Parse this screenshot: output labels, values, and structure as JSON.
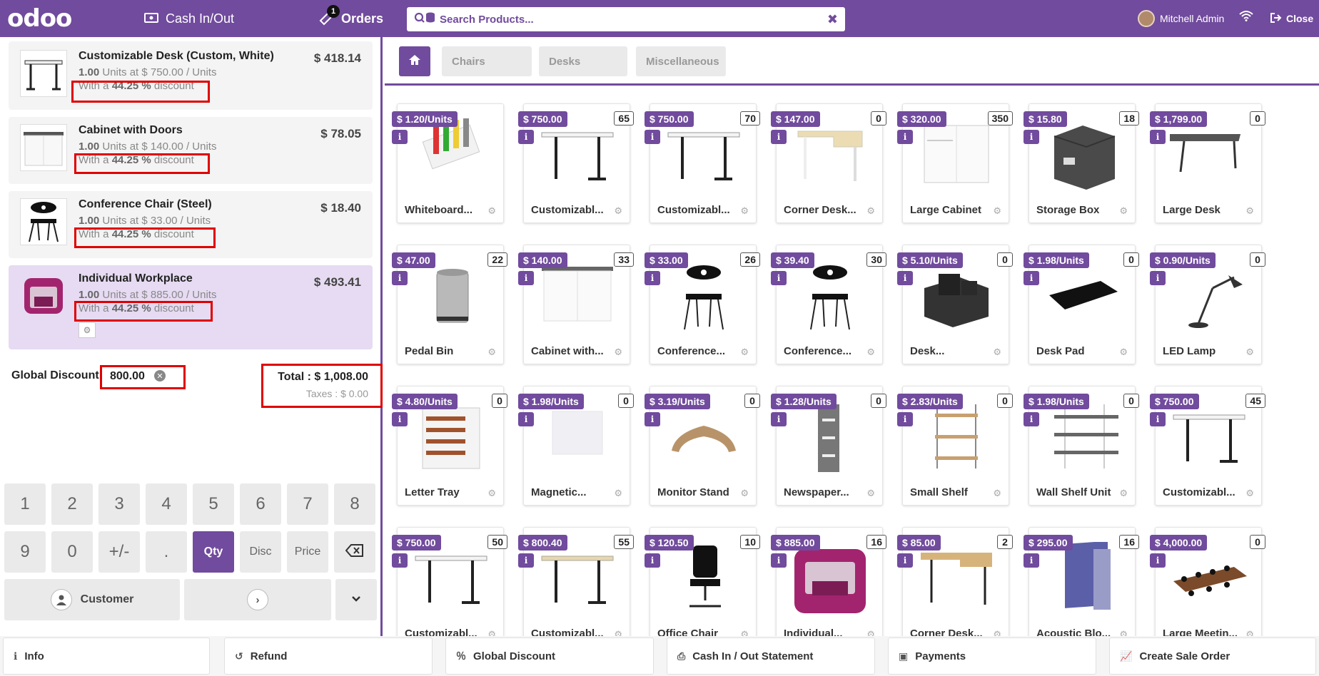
{
  "header": {
    "logo": "odoo",
    "cash_label": "Cash In/Out",
    "orders_label": "Orders",
    "orders_badge": "1",
    "search_placeholder": "Search Products...",
    "user_name": "Mitchell Admin",
    "close_label": "Close",
    "accent_color": "#714b9d"
  },
  "order": {
    "lines": [
      {
        "name": "Customizable Desk (Custom, White)",
        "price": "$ 418.14",
        "qty": "1.00",
        "unit_info": "Units at $ 750.00 / Units",
        "discount_prefix": "With a",
        "discount_value": "44.25 %",
        "discount_suffix": "discount"
      },
      {
        "name": "Cabinet with Doors",
        "price": "$ 78.05",
        "qty": "1.00",
        "unit_info": "Units at $ 140.00 / Units",
        "discount_prefix": "With a",
        "discount_value": "44.25 %",
        "discount_suffix": "discount"
      },
      {
        "name": "Conference Chair (Steel)",
        "price": "$ 18.40",
        "qty": "1.00",
        "unit_info": "Units at $ 33.00 / Units",
        "discount_prefix": "With a",
        "discount_value": "44.25 %",
        "discount_suffix": "discount"
      },
      {
        "name": "Individual Workplace",
        "price": "$ 493.41",
        "qty": "1.00",
        "unit_info": "Units at $ 885.00 / Units",
        "discount_prefix": "With a",
        "discount_value": "44.25 %",
        "discount_suffix": "discount"
      }
    ],
    "global_discount_label": "Global Discount",
    "global_discount_value": "800.00",
    "total_label": "Total : $ 1,008.00",
    "taxes_label": "Taxes : $ 0.00"
  },
  "numpad": {
    "row1": [
      "1",
      "2",
      "3",
      "4",
      "5",
      "6",
      "7",
      "8"
    ],
    "row2": [
      "9",
      "0",
      "+/-",
      ".",
      "Qty",
      "Disc",
      "Price"
    ],
    "customer_label": "Customer"
  },
  "categories": [
    "Chairs",
    "Desks",
    "Miscellaneous"
  ],
  "products": [
    {
      "name": "Whiteboard...",
      "price": "$ 1.20/Units",
      "qty": ""
    },
    {
      "name": "Customizabl...",
      "price": "$ 750.00",
      "qty": "65"
    },
    {
      "name": "Customizabl...",
      "price": "$ 750.00",
      "qty": "70"
    },
    {
      "name": "Corner Desk...",
      "price": "$ 147.00",
      "qty": "0"
    },
    {
      "name": "Large Cabinet",
      "price": "$ 320.00",
      "qty": "350"
    },
    {
      "name": "Storage Box",
      "price": "$ 15.80",
      "qty": "18"
    },
    {
      "name": "Large Desk",
      "price": "$ 1,799.00",
      "qty": "0"
    },
    {
      "name": "Pedal Bin",
      "price": "$ 47.00",
      "qty": "22"
    },
    {
      "name": "Cabinet with...",
      "price": "$ 140.00",
      "qty": "33"
    },
    {
      "name": "Conference...",
      "price": "$ 33.00",
      "qty": "26"
    },
    {
      "name": "Conference...",
      "price": "$ 39.40",
      "qty": "30"
    },
    {
      "name": "Desk...",
      "price": "$ 5.10/Units",
      "qty": "0"
    },
    {
      "name": "Desk Pad",
      "price": "$ 1.98/Units",
      "qty": "0"
    },
    {
      "name": "LED Lamp",
      "price": "$ 0.90/Units",
      "qty": "0"
    },
    {
      "name": "Letter Tray",
      "price": "$ 4.80/Units",
      "qty": "0"
    },
    {
      "name": "Magnetic...",
      "price": "$ 1.98/Units",
      "qty": "0"
    },
    {
      "name": "Monitor Stand",
      "price": "$ 3.19/Units",
      "qty": "0"
    },
    {
      "name": "Newspaper...",
      "price": "$ 1.28/Units",
      "qty": "0"
    },
    {
      "name": "Small Shelf",
      "price": "$ 2.83/Units",
      "qty": "0"
    },
    {
      "name": "Wall Shelf Unit",
      "price": "$ 1.98/Units",
      "qty": "0"
    },
    {
      "name": "Customizabl...",
      "price": "$ 750.00",
      "qty": "45"
    },
    {
      "name": "Customizabl...",
      "price": "$ 750.00",
      "qty": "50"
    },
    {
      "name": "Customizabl...",
      "price": "$ 800.40",
      "qty": "55"
    },
    {
      "name": "Office Chair",
      "price": "$ 120.50",
      "qty": "10"
    },
    {
      "name": "Individual...",
      "price": "$ 885.00",
      "qty": "16"
    },
    {
      "name": "Corner Desk...",
      "price": "$ 85.00",
      "qty": "2"
    },
    {
      "name": "Acoustic Blo...",
      "price": "$ 295.00",
      "qty": "16"
    },
    {
      "name": "Large Meetin...",
      "price": "$ 4,000.00",
      "qty": "0"
    }
  ],
  "actions": [
    "Info",
    "Refund",
    "Global Discount",
    "Cash In / Out Statement",
    "Payments",
    "Create Sale Order"
  ]
}
